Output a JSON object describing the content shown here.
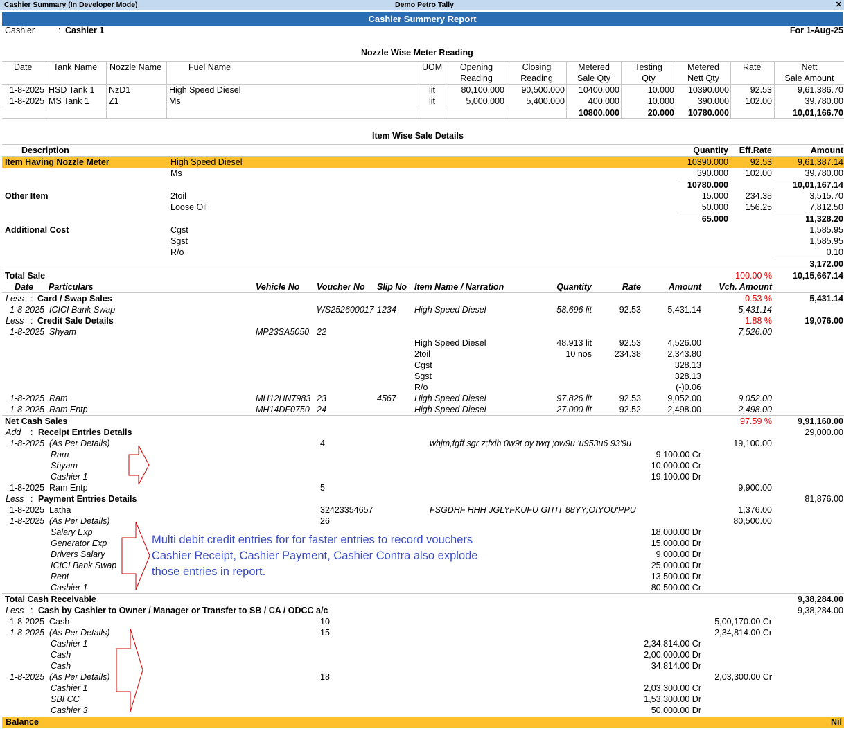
{
  "titlebar": {
    "left": "Cashier Summary (In Developer Mode)",
    "center": "Demo Petro Tally",
    "close": "x"
  },
  "report_title": "Cashier Summery Report",
  "header": {
    "cashier_label": "Cashier",
    "cashier_sep": ":",
    "cashier_value": "Cashier 1",
    "period": "For 1-Aug-25"
  },
  "nozzle": {
    "title": "Nozzle Wise Meter Reading",
    "headers": {
      "date": "Date",
      "tank": "Tank Name",
      "nozzle": "Nozzle Name",
      "fuel": "Fuel Name",
      "uom": "UOM",
      "opening1": "Opening",
      "opening2": "Reading",
      "closing1": "Closing",
      "closing2": "Reading",
      "metered1": "Metered",
      "metered2": "Sale Qty",
      "testing1": "Testing",
      "testing2": "Qty",
      "nett1": "Metered",
      "nett2": "Nett Qty",
      "rate": "Rate",
      "amount1": "Nett",
      "amount2": "Sale Amount"
    },
    "rows": [
      {
        "date": "1-8-2025",
        "tank": "HSD Tank 1",
        "nozzle": "NzD1",
        "fuel": "High Speed Diesel",
        "uom": "lit",
        "opening": "80,100.000",
        "closing": "90,500.000",
        "metered": "10400.000",
        "testing": "10.000",
        "nett": "10390.000",
        "rate": "92.53",
        "amount": "9,61,386.70"
      },
      {
        "date": "1-8-2025",
        "tank": "MS Tank 1",
        "nozzle": "Z1",
        "fuel": "Ms",
        "uom": "lit",
        "opening": "5,000.000",
        "closing": "5,400.000",
        "metered": "400.000",
        "testing": "10.000",
        "nett": "390.000",
        "rate": "102.00",
        "amount": "39,780.00"
      }
    ],
    "totals": {
      "metered": "10800.000",
      "testing": "20.000",
      "nett": "10780.000",
      "amount": "10,01,166.70"
    }
  },
  "items": {
    "title": "Item Wise Sale Details",
    "h_desc": "Description",
    "h_qty": "Quantity",
    "h_rate": "Eff.Rate",
    "h_amt": "Amount",
    "nozzle_group": "Item Having Nozzle Meter",
    "n1": {
      "name": "High Speed Diesel",
      "qty": "10390.000",
      "rate": "92.53",
      "amt": "9,61,387.14"
    },
    "n2": {
      "name": "Ms",
      "qty": "390.000",
      "rate": "102.00",
      "amt": "39,780.00"
    },
    "n_tot": {
      "qty": "10780.000",
      "amt": "10,01,167.14"
    },
    "other_group": "Other Item",
    "o1": {
      "name": "2toil",
      "qty": "15.000",
      "rate": "234.38",
      "amt": "3,515.70"
    },
    "o2": {
      "name": "Loose Oil",
      "qty": "50.000",
      "rate": "156.25",
      "amt": "7,812.50"
    },
    "o_tot": {
      "qty": "65.000",
      "amt": "11,328.20"
    },
    "add_group": "Additional Cost",
    "a1": {
      "name": "Cgst",
      "amt": "1,585.95"
    },
    "a2": {
      "name": "Sgst",
      "amt": "1,585.95"
    },
    "a3": {
      "name": "R/o",
      "amt": "0.10"
    },
    "a_tot": "3,172.00"
  },
  "sale": {
    "total_label": "Total Sale",
    "total_pct": "100.00 %",
    "total_amt": "10,15,667.14",
    "cols": {
      "date": "Date",
      "part": "Particulars",
      "veh": "Vehicle No",
      "vch": "Voucher No",
      "slip": "Slip No",
      "item": "Item Name / Narration",
      "qty": "Quantity",
      "rate": "Rate",
      "amt": "Amount",
      "vamt": "Vch. Amount"
    },
    "less": "Less",
    "sep": ":",
    "card_label": "Card / Swap Sales",
    "card_pct": "0.53 %",
    "card_amt": "5,431.14",
    "card_row": {
      "date": "1-8-2025",
      "part": "ICICI Bank Swap",
      "vch": "WS252600017",
      "slip": "1234",
      "item": "High Speed Diesel",
      "qty": "58.696 lit",
      "rate": "92.53",
      "amt": "5,431.14",
      "vamt": "5,431.14"
    },
    "credit_label": "Credit Sale Details",
    "credit_pct": "1.88 %",
    "credit_amt": "19,076.00",
    "shyam": {
      "date": "1-8-2025",
      "part": "Shyam",
      "veh": "MP23SA5050",
      "vch": "22",
      "vamt": "7,526.00"
    },
    "shyam_items": [
      {
        "item": "High Speed Diesel",
        "qty": "48.913 lit",
        "rate": "92.53",
        "amt": "4,526.00"
      },
      {
        "item": "2toil",
        "qty": "10 nos",
        "rate": "234.38",
        "amt": "2,343.80"
      },
      {
        "item": "Cgst",
        "qty": "",
        "rate": "",
        "amt": "328.13"
      },
      {
        "item": "Sgst",
        "qty": "",
        "rate": "",
        "amt": "328.13"
      },
      {
        "item": "R/o",
        "qty": "",
        "rate": "",
        "amt": "(-)0.06"
      }
    ],
    "ram": {
      "date": "1-8-2025",
      "part": "Ram",
      "veh": "MH12HN7983",
      "vch": "23",
      "slip": "4567",
      "item": "High Speed Diesel",
      "qty": "97.826 lit",
      "rate": "92.53",
      "amt": "9,052.00",
      "vamt": "9,052.00"
    },
    "ramentp": {
      "date": "1-8-2025",
      "part": "Ram Entp",
      "veh": "MH14DF0750",
      "vch": "24",
      "item": "High Speed Diesel",
      "qty": "27.000 lit",
      "rate": "92.52",
      "amt": "2,498.00",
      "vamt": "2,498.00"
    },
    "net_label": "Net Cash Sales",
    "net_pct": "97.59 %",
    "net_amt": "9,91,160.00"
  },
  "receipt": {
    "add": "Add",
    "label": "Receipt Entries Details",
    "amt": "29,000.00",
    "r1": {
      "date": "1-8-2025",
      "part": "(As Per Details)",
      "vch": "4",
      "narr": "whjm,fgff sgr z;fxih 0w9t oy twq ;ow9u 'u953u6  93'9u",
      "vamt": "19,100.00"
    },
    "r1_sub": [
      {
        "name": "Ram",
        "amt": "9,100.00 Cr"
      },
      {
        "name": "Shyam",
        "amt": "10,000.00 Cr"
      },
      {
        "name": "Cashier 1",
        "amt": "19,100.00 Dr"
      }
    ],
    "r2": {
      "date": "1-8-2025",
      "part": "Ram Entp",
      "vch": "5",
      "vamt": "9,900.00"
    }
  },
  "payment": {
    "less": "Less",
    "label": "Payment Entries Details",
    "amt": "81,876.00",
    "p1": {
      "date": "1-8-2025",
      "part": "Latha",
      "vch": "32423354657",
      "narr": "FSGDHF HHH JGLYFKUFU GITIT 88YY;OIYOU'PPU",
      "vamt": "1,376.00"
    },
    "p2": {
      "date": "1-8-2025",
      "part": "(As Per Details)",
      "vch": "26",
      "vamt": "80,500.00"
    },
    "p2_sub": [
      {
        "name": "Salary Exp",
        "amt": "18,000.00 Dr"
      },
      {
        "name": "Generator Exp",
        "amt": "15,000.00 Dr"
      },
      {
        "name": "Drivers Salary",
        "amt": "9,000.00 Dr"
      },
      {
        "name": "ICICI Bank Swap",
        "amt": "25,000.00 Dr"
      },
      {
        "name": "Rent",
        "amt": "13,500.00 Dr"
      },
      {
        "name": "Cashier 1",
        "amt": "80,500.00 Cr"
      }
    ]
  },
  "note": {
    "line1": "Multi debit credit entries for for faster entries to record vouchers",
    "line2": "Cashier Receipt, Cashier Payment, Cashier Contra also explode",
    "line3": "those entries in report."
  },
  "cash": {
    "total_label": "Total Cash Receivable",
    "total_amt": "9,38,284.00",
    "less": "Less",
    "label": "Cash by Cashier to Owner / Manager or Transfer to SB / CA / ODCC a/c",
    "amt": "9,38,284.00",
    "c1": {
      "date": "1-8-2025",
      "part": "Cash",
      "vch": "10",
      "vamt": "5,00,170.00 Cr"
    },
    "c2": {
      "date": "1-8-2025",
      "part": "(As Per Details)",
      "vch": "15",
      "vamt": "2,34,814.00 Cr"
    },
    "c2_sub": [
      {
        "name": "Cashier 1",
        "amt": "2,34,814.00 Cr"
      },
      {
        "name": "Cash",
        "amt": "2,00,000.00 Dr"
      },
      {
        "name": "Cash",
        "amt": "34,814.00 Dr"
      }
    ],
    "c3": {
      "date": "1-8-2025",
      "part": "(As Per Details)",
      "vch": "18",
      "vamt": "2,03,300.00 Cr"
    },
    "c3_sub": [
      {
        "name": "Cashier 1",
        "amt": "2,03,300.00 Cr"
      },
      {
        "name": "SBI CC",
        "amt": "1,53,300.00 Dr"
      },
      {
        "name": "Cashier 3",
        "amt": "50,000.00 Dr"
      }
    ]
  },
  "balance": {
    "label": "Balance",
    "value": "Nil"
  },
  "colors": {
    "highlight": "#fec02c",
    "header_blue": "#2a6db3",
    "titlebar": "#c3d9f0",
    "negative": "#e00000",
    "annotation": "#3a4cc4",
    "arrow": "#d00000"
  },
  "icons": {
    "close": "close-icon",
    "arrow": "right-arrow-icon"
  }
}
